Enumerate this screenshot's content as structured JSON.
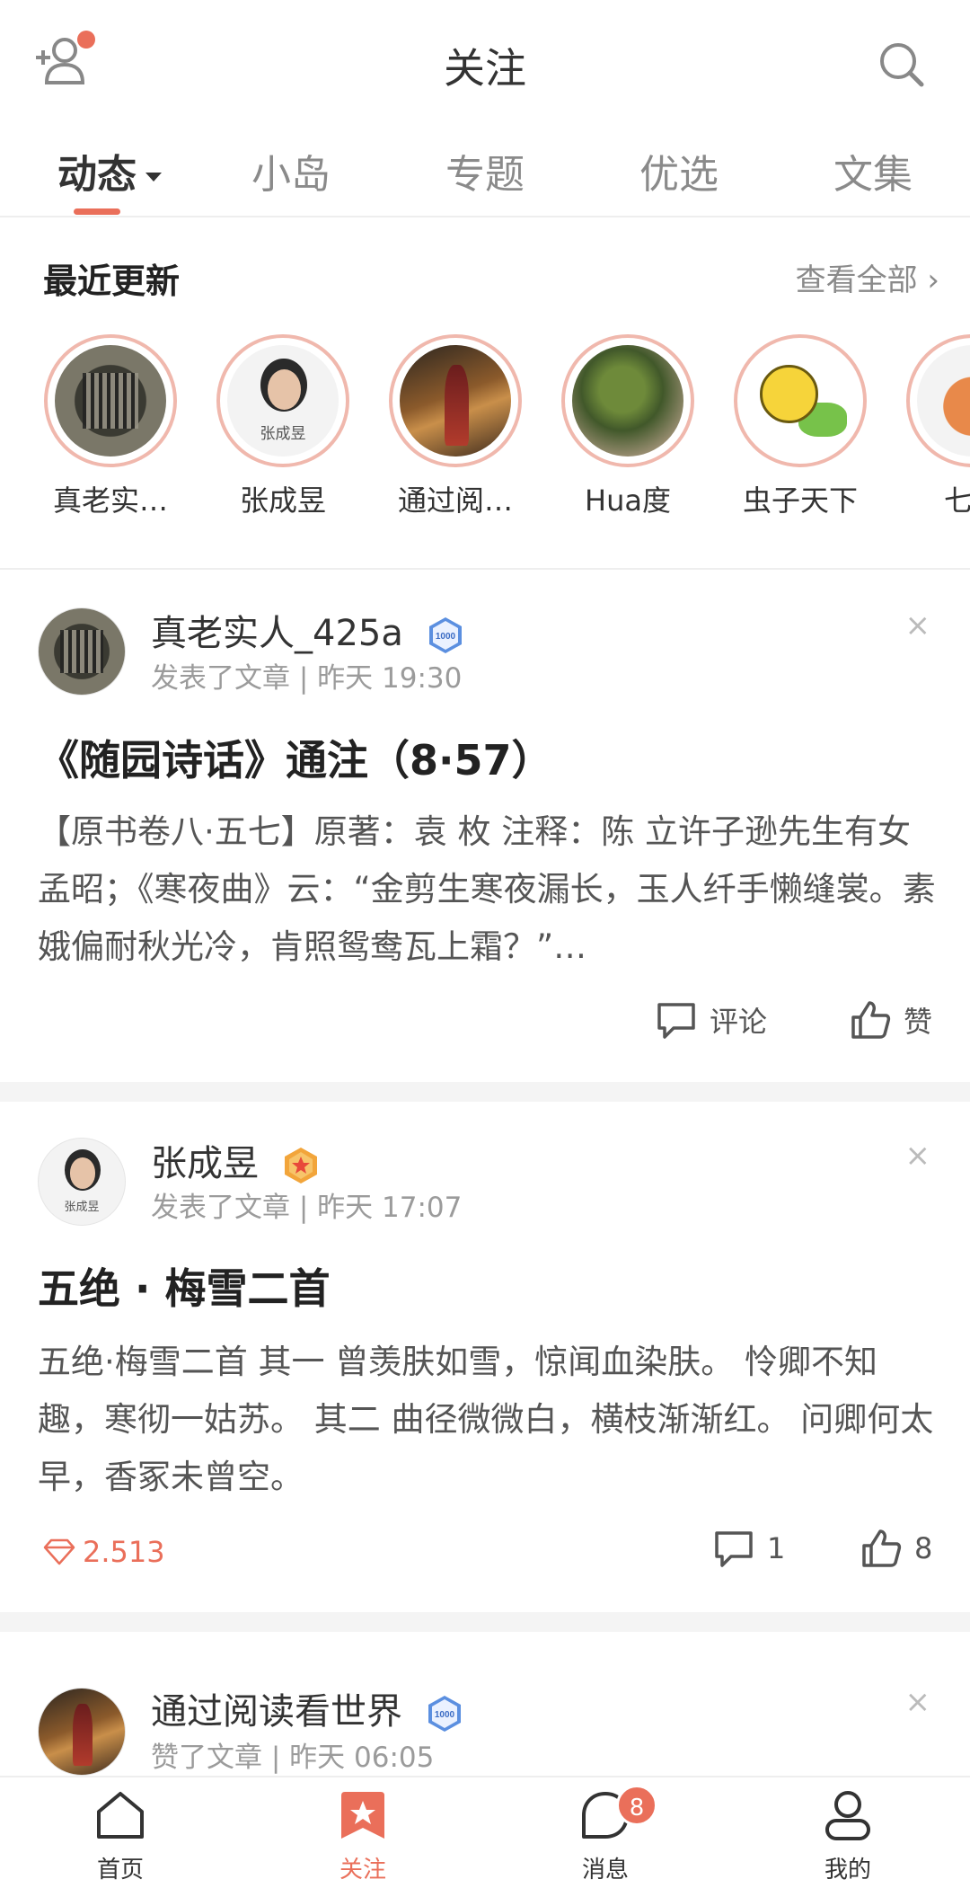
{
  "header": {
    "title": "关注",
    "add_friend_icon": "add-person-icon",
    "search_icon": "search-icon",
    "accent_color": "#ea6f5a"
  },
  "tabs": [
    {
      "label": "动态",
      "active": true
    },
    {
      "label": "小岛",
      "active": false
    },
    {
      "label": "专题",
      "active": false
    },
    {
      "label": "优选",
      "active": false
    },
    {
      "label": "文集",
      "active": false
    }
  ],
  "recent": {
    "heading": "最近更新",
    "view_all": "查看全部 ›",
    "users": [
      {
        "name": "真老实…"
      },
      {
        "name": "张成昱",
        "avatar_caption": "张成昱"
      },
      {
        "name": "通过阅…"
      },
      {
        "name": "Hua度"
      },
      {
        "name": "虫子天下"
      },
      {
        "name": "七七"
      }
    ]
  },
  "feed": [
    {
      "author": "真老实人_425a",
      "badge": "1000",
      "meta": "发表了文章 | 昨天 19:30",
      "title": "《随园诗话》通注（8·57）",
      "excerpt": "【原书卷八·五七】原著：袁 枚 注释：陈 立许子逊先生有女孟昭；《寒夜曲》云：“金剪生寒夜漏长，玉人纤手懒缝裳。素娥偏耐秋光冷，肯照鸳鸯瓦上霜？”…",
      "comment_label": "评论",
      "like_label": "赞"
    },
    {
      "author": "张成昱",
      "avatar_caption": "张成昱",
      "meta": "发表了文章 | 昨天 17:07",
      "title": "五绝 · 梅雪二首",
      "excerpt": "五绝·梅雪二首 其一 曾羡肤如雪，惊闻血染肤。 怜卿不知趣，寒彻一姑苏。 其二 曲径微微白，横枝渐渐红。 问卿何太早，香冢未曾空。",
      "diamonds": "2.513",
      "comments": "1",
      "likes": "8"
    },
    {
      "author": "通过阅读看世界",
      "badge": "1000",
      "meta": "赞了文章 | 昨天 06:05"
    }
  ],
  "close_symbol": "×",
  "bottom_nav": [
    {
      "label": "首页",
      "icon": "home-icon"
    },
    {
      "label": "关注",
      "icon": "follow-star-icon",
      "active": true
    },
    {
      "label": "消息",
      "icon": "message-icon",
      "badge": "8"
    },
    {
      "label": "我的",
      "icon": "profile-icon"
    }
  ]
}
